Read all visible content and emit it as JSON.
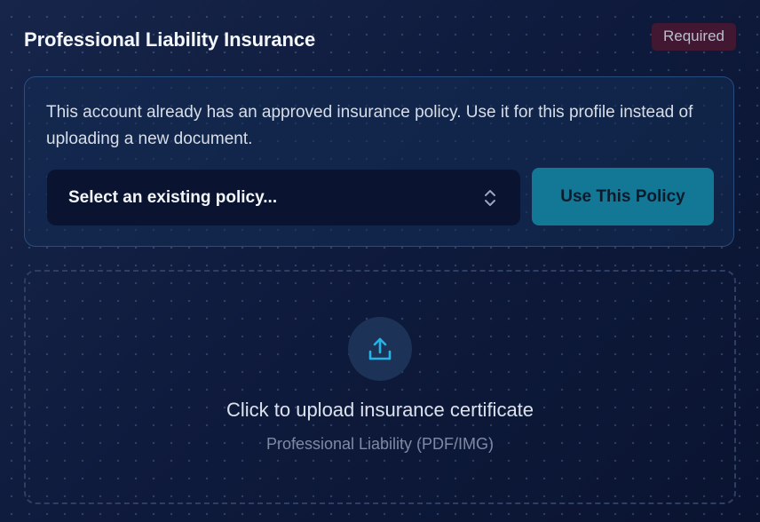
{
  "section": {
    "title": "Professional Liability Insurance",
    "required_badge": "Required"
  },
  "existing_policy": {
    "message": "This account already has an approved insurance policy. Use it for this profile instead of uploading a new document.",
    "select": {
      "selected_value": "Select an existing policy...",
      "icon": "chevron-up-down-icon"
    },
    "use_button_label": "Use This Policy"
  },
  "upload": {
    "icon": "upload-icon",
    "title": "Click to upload insurance certificate",
    "subtitle": "Professional Liability (PDF/IMG)"
  },
  "colors": {
    "background": "#0d1733",
    "accent_button": "#137895",
    "icon_accent": "#23b4e8",
    "badge_bg": "#5a1628"
  }
}
